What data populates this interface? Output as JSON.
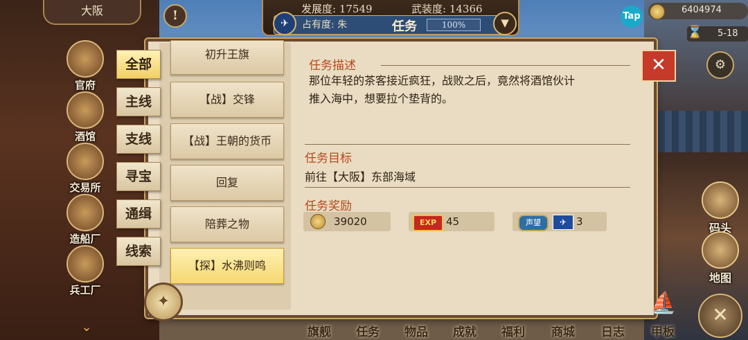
{
  "header": {
    "city": "大阪",
    "development_label": "发展度:",
    "development_value": "17549",
    "military_label": "武装度:",
    "military_value": "14366",
    "occupancy_label": "占有度: 朱",
    "task_title": "任务",
    "task_progress": "100%",
    "tap_label": "Tap",
    "coins": "6404974",
    "date": "5-18"
  },
  "left_nav": [
    {
      "label": "官府",
      "icon": "crown-icon"
    },
    {
      "label": "酒馆",
      "icon": "tankard-icon"
    },
    {
      "label": "交易所",
      "icon": "scales-icon"
    },
    {
      "label": "造船厂",
      "icon": "ship-icon"
    },
    {
      "label": "兵工厂",
      "icon": "cannon-icon"
    }
  ],
  "category_tabs": [
    "全部",
    "主线",
    "支线",
    "寻宝",
    "通缉",
    "线索"
  ],
  "active_category": 0,
  "task_list": [
    "初升王旗",
    "【战】交锋",
    "【战】王朝的货币",
    "回复",
    "陪葬之物",
    "【探】水沸则鸣"
  ],
  "active_task": 5,
  "detail": {
    "desc_title": "任务描述",
    "desc_line1": "那位年轻的茶客接近疯狂，战败之后，竟然将酒馆伙计",
    "desc_line2": "推入海中，想要拉个垫背的。",
    "goal_title": "任务目标",
    "goal_text": "前往【大阪】东部海域",
    "reward_title": "任务奖励",
    "rewards": {
      "coins": "39020",
      "exp_badge": "EXP",
      "exp": "45",
      "reputation_badge": "声望",
      "reputation": "3"
    }
  },
  "right_nav": [
    {
      "label": "码头",
      "icon": "dock-icon"
    },
    {
      "label": "地图",
      "icon": "map-scroll-icon"
    }
  ],
  "bottom_nav": [
    "旗舰",
    "任务",
    "物品",
    "成就",
    "福利",
    "商城",
    "日志",
    "甲板"
  ],
  "colors": {
    "accent_red": "#c63a2a",
    "section_title": "#b34a1e",
    "active_tab": "#f1cf63"
  }
}
